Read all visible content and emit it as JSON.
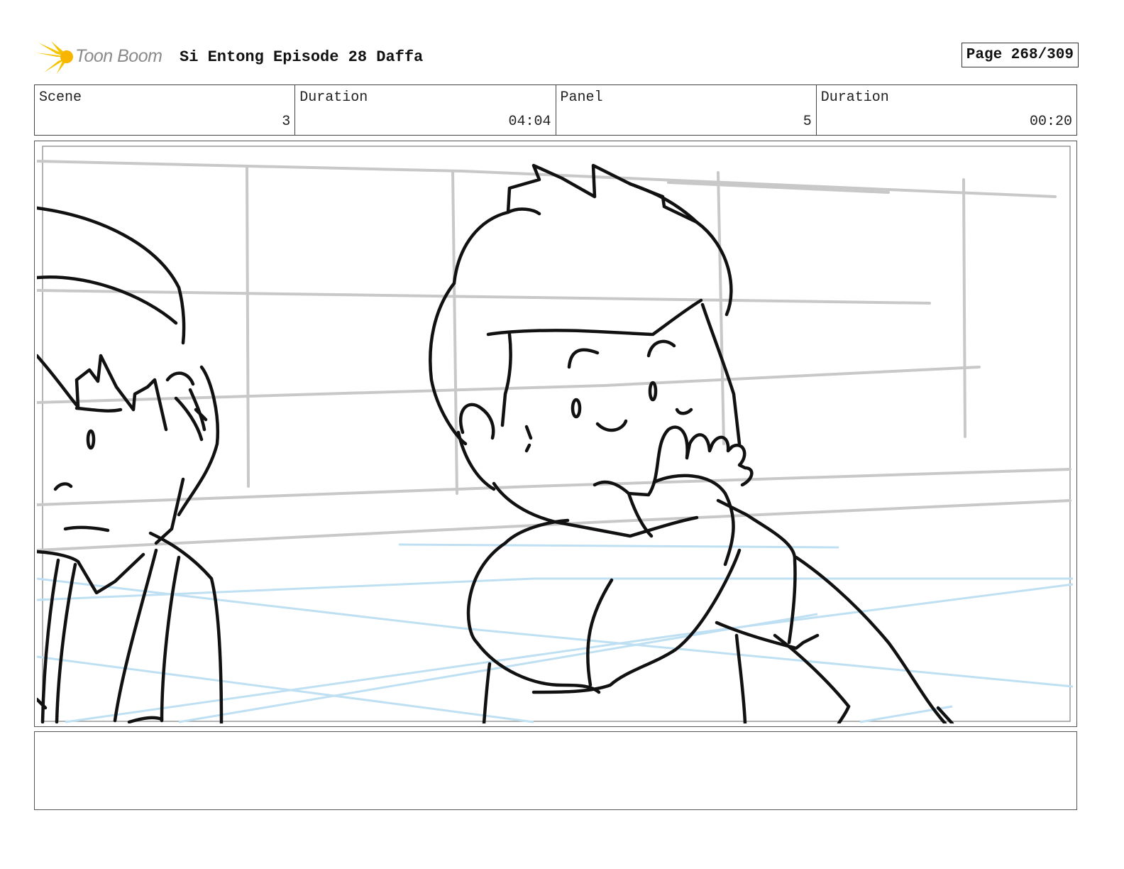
{
  "header": {
    "logo_text": "Toon Boom",
    "title": "Si Entong Episode 28 Daffa",
    "page_label": "Page 268/309"
  },
  "info": [
    {
      "label": "Scene",
      "value": "3"
    },
    {
      "label": "Duration",
      "value": "04:04"
    },
    {
      "label": "Panel",
      "value": "5"
    },
    {
      "label": "Duration",
      "value": "00:20"
    }
  ],
  "notes": {
    "text": ""
  },
  "colors": {
    "logo_accent": "#f5c400",
    "sketch_line": "#111111",
    "grid_line": "#c8c8c8",
    "floor_line": "#bfe0f2"
  }
}
